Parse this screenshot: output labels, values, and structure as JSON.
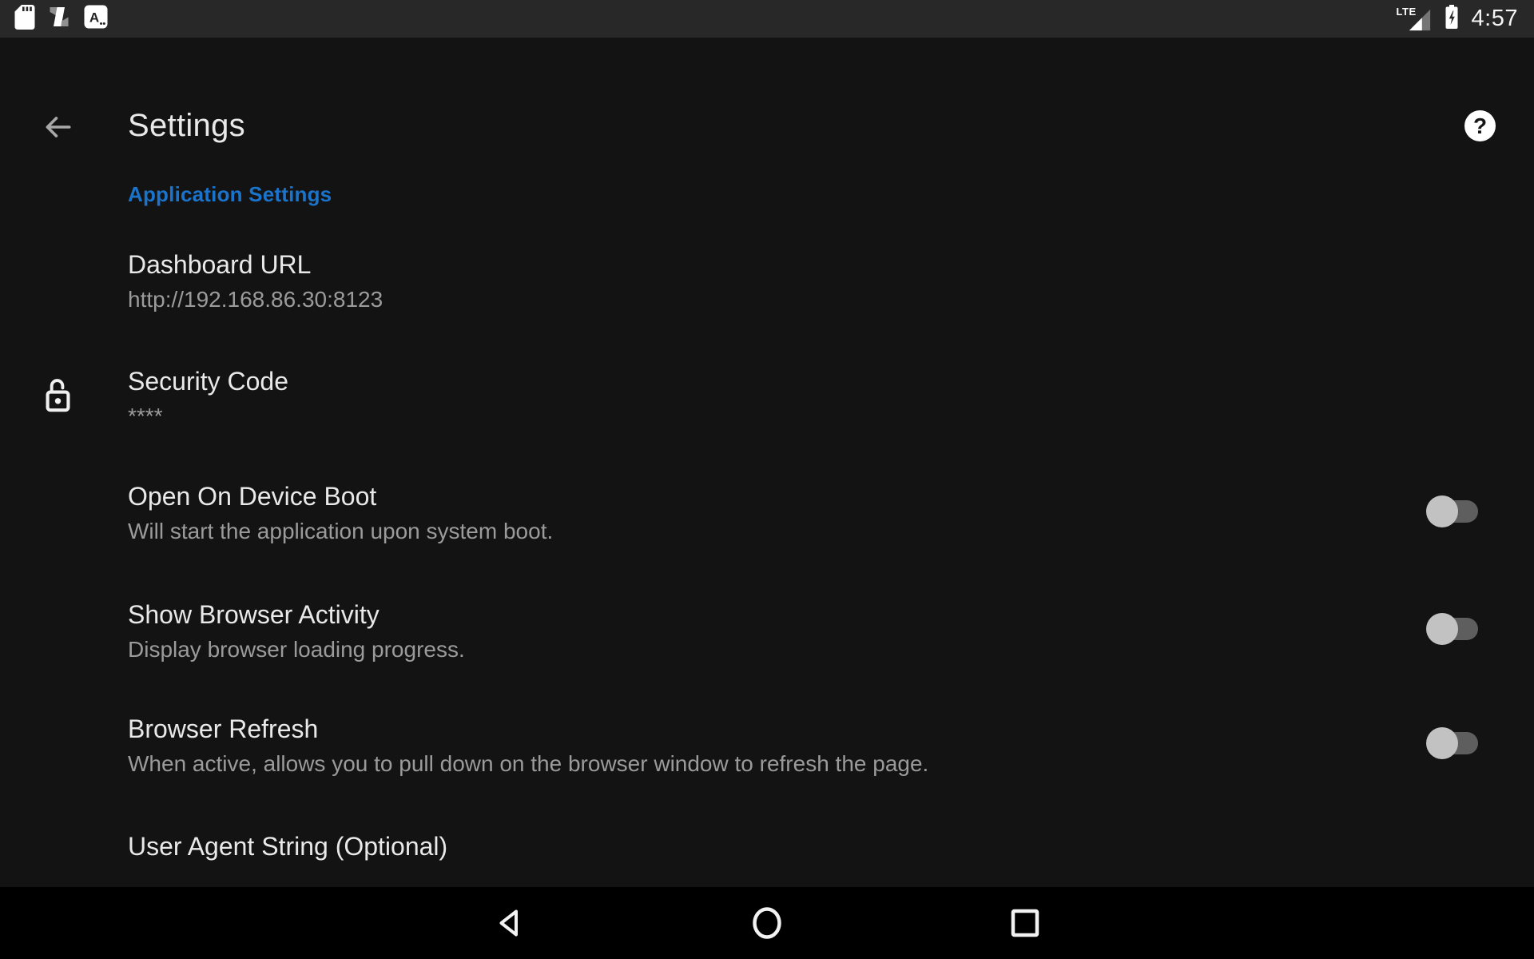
{
  "status_bar": {
    "time": "4:57",
    "network_label": "LTE",
    "a_icon_letter": "A",
    "icons_left": [
      "sd-card-icon",
      "android-n-icon",
      "a-app-icon"
    ],
    "battery": "charging"
  },
  "header": {
    "title": "Settings",
    "help_glyph": "?"
  },
  "section": {
    "label": "Application Settings"
  },
  "settings": [
    {
      "title": "Dashboard URL",
      "subtitle": "http://192.168.86.30:8123"
    },
    {
      "title": "Security Code",
      "subtitle": "****",
      "icon": "lock-open"
    },
    {
      "title": "Open On Device Boot",
      "subtitle": "Will start the application upon system boot.",
      "toggle": "off"
    },
    {
      "title": "Show Browser Activity",
      "subtitle": "Display browser loading progress.",
      "toggle": "off"
    },
    {
      "title": "Browser Refresh",
      "subtitle": "When active, allows you to pull down on the browser window to refresh the page.",
      "toggle": "off"
    },
    {
      "title": "User Agent String (Optional)"
    }
  ],
  "nav_bar": {
    "buttons": [
      "back",
      "home",
      "recents"
    ]
  },
  "colors": {
    "accent_blue": "#1b74cb",
    "background": "#131313",
    "status_bar_bg": "#282828",
    "nav_bar_bg": "#000000",
    "title_text": "#e9e9e9",
    "subtitle_text": "#9b9b9b",
    "toggle_track_off": "#5e5e5e",
    "toggle_thumb_off": "#c2c2c2"
  }
}
